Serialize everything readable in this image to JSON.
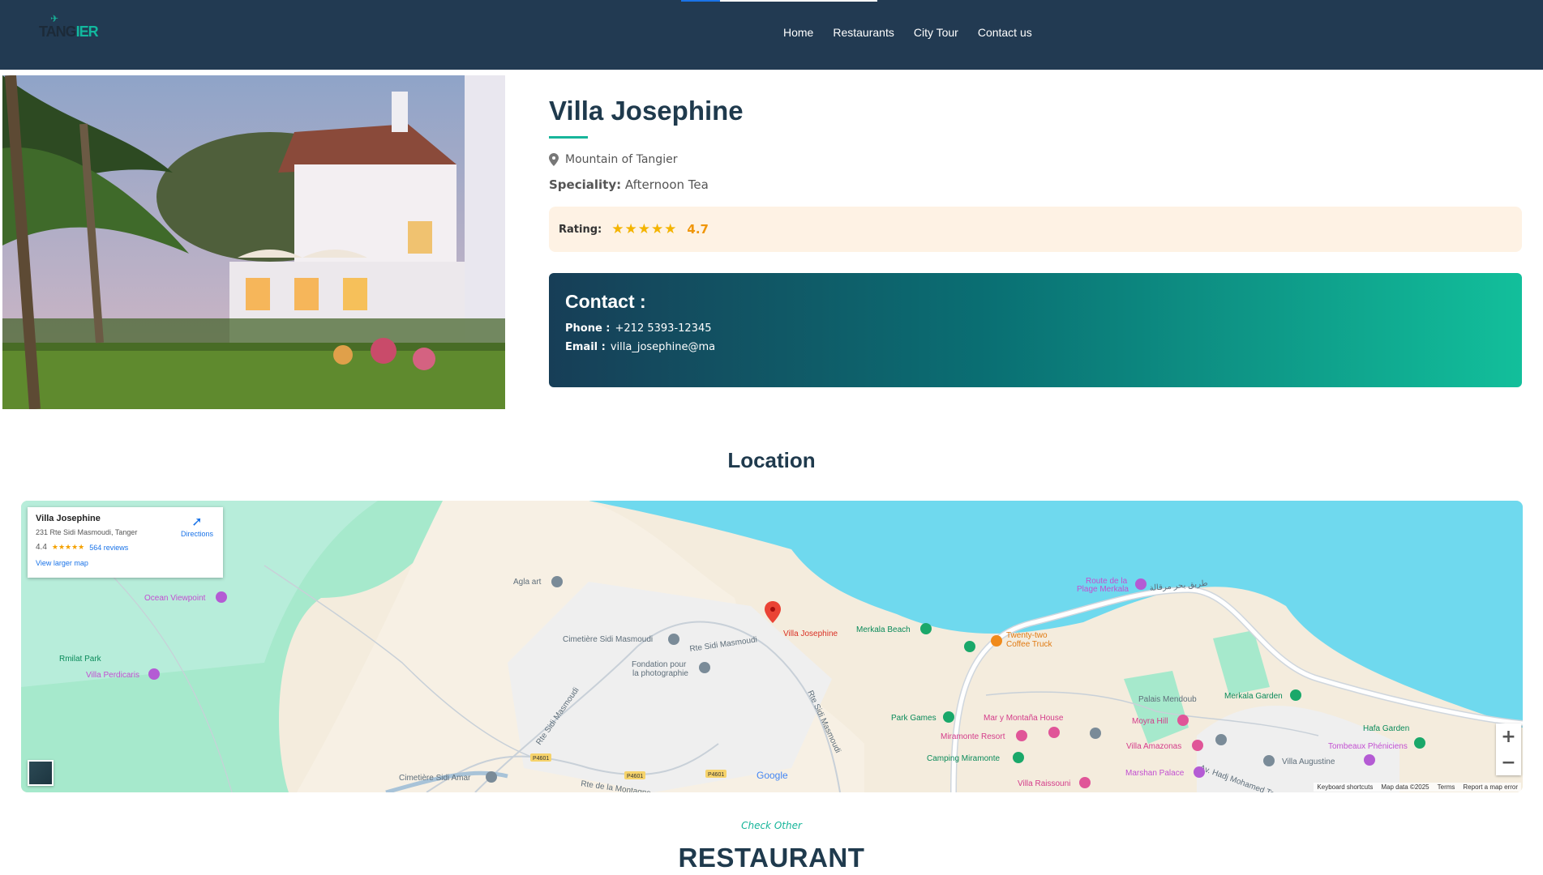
{
  "nav": {
    "logo_part1": "TANG",
    "logo_part2": "IER",
    "items": [
      "Home",
      "Restaurants",
      "City Tour",
      "Contact us"
    ]
  },
  "restaurant": {
    "name": "Villa Josephine",
    "location": "Mountain of Tangier",
    "speciality_label": "Speciality:",
    "speciality": "Afternoon Tea",
    "rating_label": "Rating:",
    "rating_value": "4.7",
    "stars": 5,
    "contact_title": "Contact :",
    "phone_label": "Phone :",
    "phone": "+212 5393-12345",
    "email_label": "Email :",
    "email": "villa_josephine@ma"
  },
  "location_section": {
    "title": "Location"
  },
  "map": {
    "card": {
      "place": "Villa Josephine",
      "address": "231 Rte Sidi Masmoudi, Tanger",
      "rating": "4.4",
      "reviews": "564 reviews",
      "view_larger": "View larger map",
      "directions": "Directions"
    },
    "labels": {
      "agla_art": "Agla art",
      "ocean_viewpoint": "Ocean Viewpoint",
      "rmilat_park": "Rmilat Park",
      "villa_perdicaris": "Villa Perdicaris",
      "cimetiere_sidi_masmoudi": "Cimetière Sidi Masmoudi",
      "rte_sidi_masmoudi": "Rte Sidi Masmoudi",
      "fondation_1": "Fondation pour",
      "fondation_2": "la photographie",
      "villa_josephine": "Villa Josephine",
      "merkala_beach": "Merkala Beach",
      "twenty_two_1": "Twenty-two",
      "twenty_two_2": "Coffee Truck",
      "route_plage_1": "Route de la",
      "route_plage_2": "Plage Merkala",
      "arabic_road": "طريق بحر مرقالة",
      "park_games": "Park Games",
      "mar_montana": "Mar y Montaña House",
      "miramonte_resort": "Miramonte Resort",
      "camping_miramonte": "Camping Miramonte",
      "villa_raissouni": "Villa Raissouni",
      "moyra_hill": "Moyra Hill",
      "palais_mendoub": "Palais Mendoub",
      "villa_amazonas": "Villa Amazonas",
      "marshan_palace": "Marshan Palace",
      "villa_augustine": "Villa Augustine",
      "tombeaux": "Tombeaux Phéniciens",
      "merkala_garden": "Merkala Garden",
      "hafa_garden": "Hafa Garden",
      "cimetiere_sidi_amar": "Cimetière Sidi Amar",
      "rte_montagne": "Rte de la Montagne",
      "av_hadj": "Av. Hadj Mohamed Torres",
      "road_p4601": "P4601",
      "rte_sidi_masmoudi_2": "Rte Sidi Masmoudi"
    },
    "google": "Google",
    "attribution": [
      "Keyboard shortcuts",
      "Map data ©2025",
      "Terms",
      "Report a map error"
    ],
    "zoom_in": "+",
    "zoom_out": "−"
  },
  "other": {
    "kicker": "Check Other",
    "title": "RESTAURANT"
  },
  "colors": {
    "nav_bg": "#223a52",
    "accent": "#17b59a",
    "rating_bg": "#fef2e4",
    "star": "#f4b400",
    "sea": "#6fd9ee"
  },
  "icons": {
    "location": "map-pin-icon",
    "directions": "directions-icon",
    "marker": "map-marker-icon"
  }
}
